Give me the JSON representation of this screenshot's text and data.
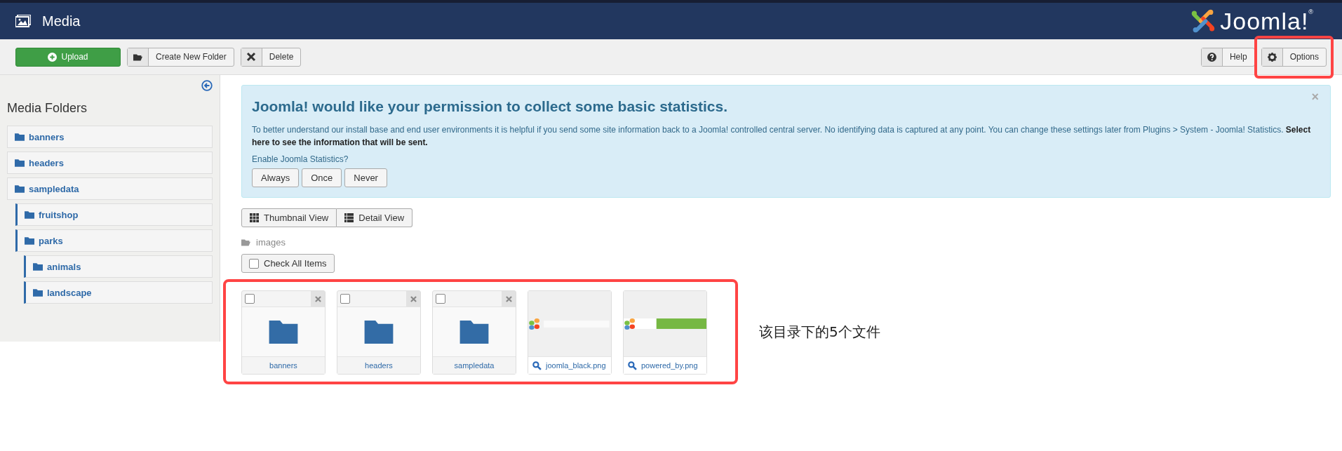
{
  "header": {
    "title": "Media",
    "brand": "Joomla!",
    "brand_mark": "®"
  },
  "toolbar": {
    "left": [
      {
        "kind": "upload",
        "label": "Upload"
      },
      {
        "kind": "folder",
        "label": "Create New Folder"
      },
      {
        "kind": "delete",
        "label": "Delete"
      }
    ],
    "right": [
      {
        "kind": "help",
        "label": "Help",
        "highlighted": false
      },
      {
        "kind": "options",
        "label": "Options",
        "highlighted": true
      }
    ]
  },
  "sidebar": {
    "title": "Media Folders",
    "items": [
      {
        "label": "banners"
      },
      {
        "label": "headers"
      },
      {
        "label": "sampledata",
        "children": [
          {
            "label": "fruitshop"
          },
          {
            "label": "parks",
            "children": [
              {
                "label": "animals"
              },
              {
                "label": "landscape"
              }
            ]
          }
        ]
      }
    ]
  },
  "notice": {
    "title": "Joomla! would like your permission to collect some basic statistics.",
    "text": "To better understand our install base and end user environments it is helpful if you send some site information back to a Joomla! controlled central server. No identifying data is captured at any point. You can change these settings later from Plugins > System - Joomla! Statistics. **Select here to see the information that will be sent.**",
    "question": "Enable Joomla Statistics?",
    "close": "×",
    "buttons": [
      "Always",
      "Once",
      "Never"
    ]
  },
  "views": [
    {
      "kind": "grid",
      "label": "Thumbnail View",
      "selected": false
    },
    {
      "kind": "list",
      "label": "Detail View",
      "selected": false
    }
  ],
  "breadcrumb": "images",
  "check_all": {
    "label": "Check All Items",
    "checked": false
  },
  "items_highlighted": true,
  "items": [
    {
      "kind": "folder",
      "name": "banners",
      "checked": false
    },
    {
      "kind": "folder",
      "name": "headers",
      "checked": false
    },
    {
      "kind": "folder",
      "name": "sampledata",
      "checked": false
    },
    {
      "name": "joomla_black.png"
    },
    {
      "name": "powered_by.png"
    }
  ],
  "annotation": "该目录下的5个文件"
}
